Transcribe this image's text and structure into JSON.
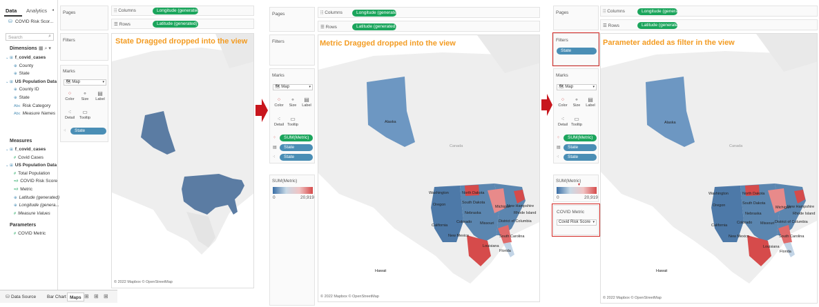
{
  "data_pane": {
    "tabs": [
      "Data",
      "Analytics"
    ],
    "source": "COVID Risk Scor...",
    "search_placeholder": "Search",
    "dimensions_label": "Dimensions",
    "dimensions": [
      {
        "text": "f_covid_cases",
        "kind": "table"
      },
      {
        "text": "County",
        "kind": "geo"
      },
      {
        "text": "State",
        "kind": "geo"
      },
      {
        "text": "US Population Data",
        "kind": "table"
      },
      {
        "text": "County ID",
        "kind": "geo"
      },
      {
        "text": "State",
        "kind": "geo"
      },
      {
        "text": "Risk Category",
        "kind": "abc"
      },
      {
        "text": "Measure Names",
        "kind": "abc"
      }
    ],
    "measures_label": "Measures",
    "measures": [
      {
        "text": "f_covid_cases",
        "kind": "table"
      },
      {
        "text": "Covid Cases",
        "kind": "num"
      },
      {
        "text": "US Population Data",
        "kind": "table"
      },
      {
        "text": "Total Population",
        "kind": "num"
      },
      {
        "text": "COVID Risk Score",
        "kind": "calc"
      },
      {
        "text": "Metric",
        "kind": "calc"
      },
      {
        "text": "Latitude (generated)",
        "kind": "geo"
      },
      {
        "text": "Longitude (genera...",
        "kind": "geo"
      },
      {
        "text": "Measure Values",
        "kind": "num"
      }
    ],
    "parameters_label": "Parameters",
    "parameters": [
      {
        "text": "COVID Metric",
        "kind": "num"
      }
    ]
  },
  "bottom_tabs": {
    "data_source": "Data Source",
    "tabs": [
      "Bar Chart",
      "Maps"
    ]
  },
  "shelves": {
    "pages": "Pages",
    "filters": "Filters",
    "marks": "Marks",
    "columns": "Columns",
    "rows": "Rows",
    "columns_pill": "Longitude (generated)",
    "rows_pill": "Latitude (generated)",
    "mark_type": "Map",
    "mark_buttons": [
      "Color",
      "Size",
      "Label",
      "Detail",
      "Tooltip"
    ]
  },
  "panel1": {
    "title": "State Dragged dropped into the view",
    "marks_pills": [
      "State"
    ]
  },
  "panel2": {
    "title": "Metric Dragged dropped into the view",
    "marks_pills": [
      "SUM(Metric)",
      "State",
      "State"
    ],
    "legend_title": "SUM(Metric)",
    "legend_min": "0",
    "legend_max": "20,919"
  },
  "panel3": {
    "title": "Parameter added as filter in the view",
    "filter_pill": "State",
    "marks_pills": [
      "SUM(Metric)",
      "State",
      "State"
    ],
    "legend_title": "SUM(Metric)",
    "legend_min": "0",
    "legend_max": "20,919",
    "param_title": "COVID Metric",
    "param_value": "Covid Risk Score"
  },
  "map": {
    "credit": "© 2022 Mapbox © OpenStreetMap",
    "labels": {
      "alaska": "Alaska",
      "canada": "Canada",
      "hawaii": "Hawaii",
      "washington": "Washington",
      "oregon": "Oregon",
      "california": "California",
      "north_dakota": "North Dakota",
      "south_dakota": "South Dakota",
      "nebraska": "Nebraska",
      "colorado": "Colorado",
      "missouri": "Missouri",
      "new_mexico": "New Mexico",
      "louisiana": "Louisiana",
      "florida": "Florida",
      "south_carolina": "South Carolina",
      "michigan": "Michigan",
      "new_hampshire": "New Hampshire",
      "rhode_island": "Rhode Island",
      "dc": "District of Columbia"
    }
  },
  "colors": {
    "green_pill": "#1ba55c",
    "blue_pill": "#4a8eb5",
    "title": "#f39c23",
    "arrow": "#c8161d",
    "map_blue": "#5b86b0",
    "map_red": "#d64b4b"
  }
}
